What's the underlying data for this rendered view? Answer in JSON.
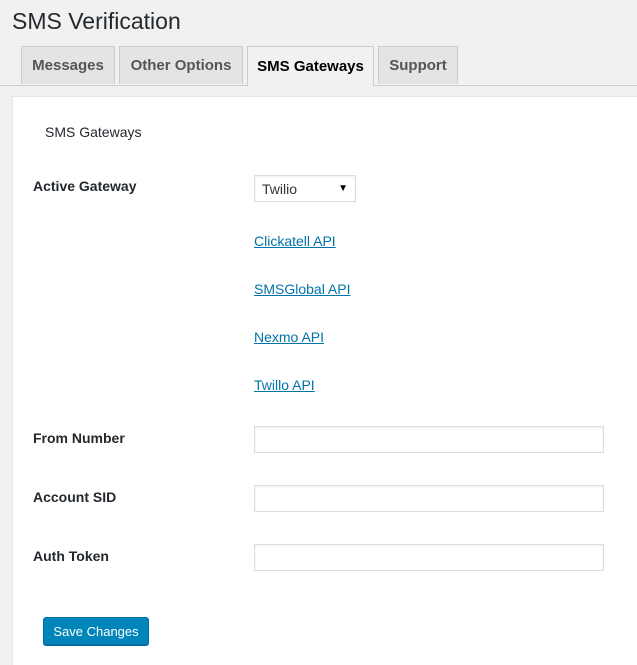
{
  "page": {
    "title": "SMS Verification"
  },
  "tabs": [
    {
      "label": "Messages",
      "active": false
    },
    {
      "label": "Other Options",
      "active": false
    },
    {
      "label": "SMS Gateways",
      "active": true
    },
    {
      "label": "Support",
      "active": false
    }
  ],
  "section": {
    "title": "SMS Gateways"
  },
  "fields": {
    "active_gateway": {
      "label": "Active Gateway",
      "value": "Twilio"
    },
    "from_number": {
      "label": "From Number",
      "value": ""
    },
    "account_sid": {
      "label": "Account SID",
      "value": ""
    },
    "auth_token": {
      "label": "Auth Token",
      "value": ""
    }
  },
  "links": [
    {
      "label": "Clickatell API"
    },
    {
      "label": "SMSGlobal API"
    },
    {
      "label": "Nexmo API"
    },
    {
      "label": "Twillo API"
    }
  ],
  "actions": {
    "save_label": "Save Changes"
  },
  "colors": {
    "link": "#0073aa",
    "primary_button": "#0085ba",
    "active_tab": "#f1f1f1"
  },
  "icons": {
    "select_arrow": "dropdown-arrow-icon"
  }
}
